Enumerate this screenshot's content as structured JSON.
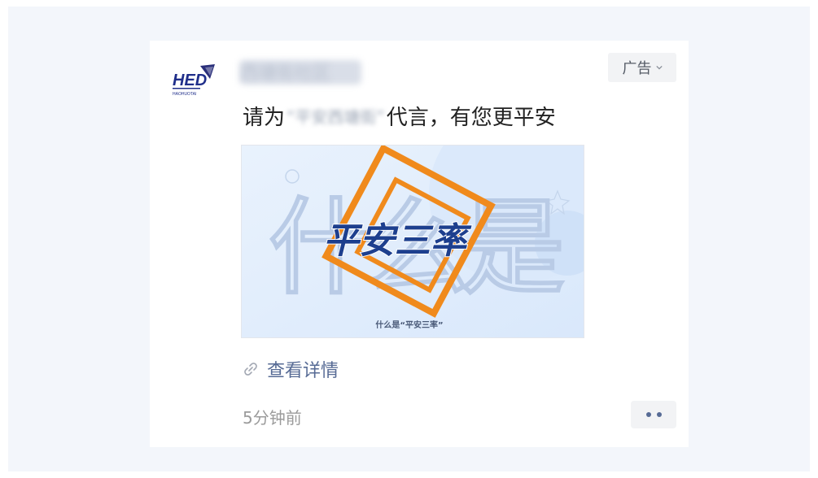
{
  "advertiser": {
    "logo_text": "HED",
    "logo_subtext": "HAOHUOTAI",
    "name": "西塘街社区"
  },
  "ad_badge": {
    "label": "广告",
    "icon": "chevron-down-icon"
  },
  "headline": {
    "prefix": "请为",
    "redacted": "“平安西塘街”",
    "suffix": "代言，有您更平安"
  },
  "creative": {
    "background_text": "什么是",
    "main_text": "平安三率",
    "caption": "什么是“平安三率”"
  },
  "detail_link": {
    "label": "查看详情",
    "icon": "link-icon"
  },
  "timestamp": "5分钟前",
  "more_button": {
    "icon": "more-dots-icon"
  },
  "colors": {
    "link": "#576b95",
    "creative_orange": "#f08a1c",
    "creative_navy": "#1d3f8e",
    "creative_bg": "#e3eefc"
  }
}
